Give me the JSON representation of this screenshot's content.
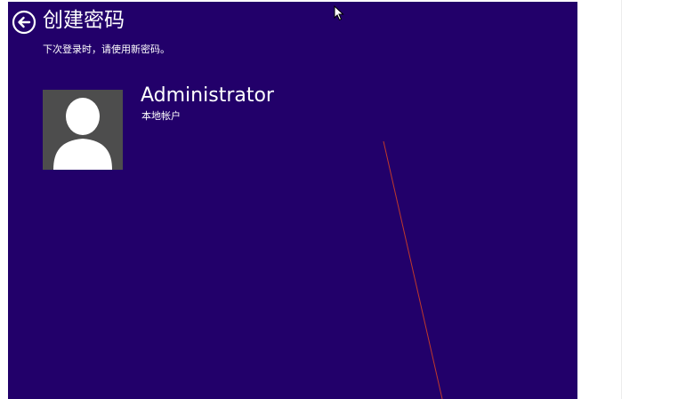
{
  "header": {
    "back_icon": "back-arrow-icon",
    "title": "创建密码",
    "subtitle": "下次登录时，请使用新密码。"
  },
  "account": {
    "avatar_icon": "user-avatar-icon",
    "name": "Administrator",
    "type": "本地帐户"
  },
  "colors": {
    "background": "#22006a",
    "avatar_background": "#4d4d4d",
    "text": "#ffffff",
    "line": "#c0392b"
  }
}
